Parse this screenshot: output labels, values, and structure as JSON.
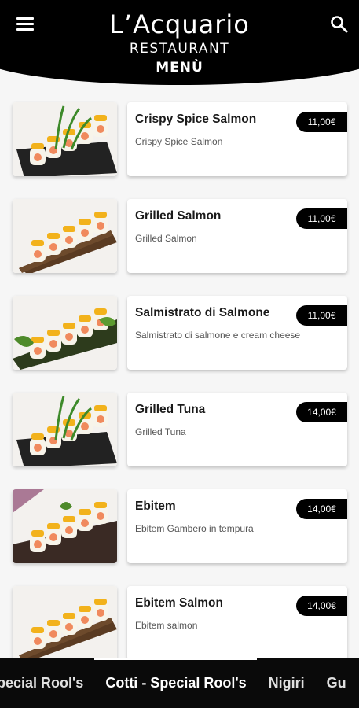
{
  "header": {
    "title": "L’Acquario",
    "subtitle": "RESTAURANT",
    "section": "MENÙ"
  },
  "items": [
    {
      "name": "Crispy Spice Salmon",
      "description": "Crispy Spice Salmon",
      "price": "11,00€",
      "image": "sushi-roll-dark-plate"
    },
    {
      "name": "Grilled Salmon",
      "description": "Grilled Salmon",
      "price": "11,00€",
      "image": "sushi-roll-wood-board"
    },
    {
      "name": "Salmistrato di Salmone",
      "description": "Salmistrato di salmone e cream cheese",
      "price": "11,00€",
      "image": "sushi-roll-leaf"
    },
    {
      "name": "Grilled Tuna",
      "description": "Grilled Tuna",
      "price": "14,00€",
      "image": "sushi-roll-dark-plate"
    },
    {
      "name": "Ebitem",
      "description": "Ebitem Gambero in tempura",
      "price": "14,00€",
      "image": "sushi-roll-tempura"
    },
    {
      "name": "Ebitem Salmon",
      "description": "Ebitem salmon",
      "price": "14,00€",
      "image": "sushi-roll-wood-board"
    }
  ],
  "categories": [
    {
      "label": "Special Rool's",
      "active": false
    },
    {
      "label": "Cotti - Special Rool's",
      "active": true
    },
    {
      "label": "Nigiri",
      "active": false
    },
    {
      "label": "Gu",
      "active": false
    }
  ]
}
